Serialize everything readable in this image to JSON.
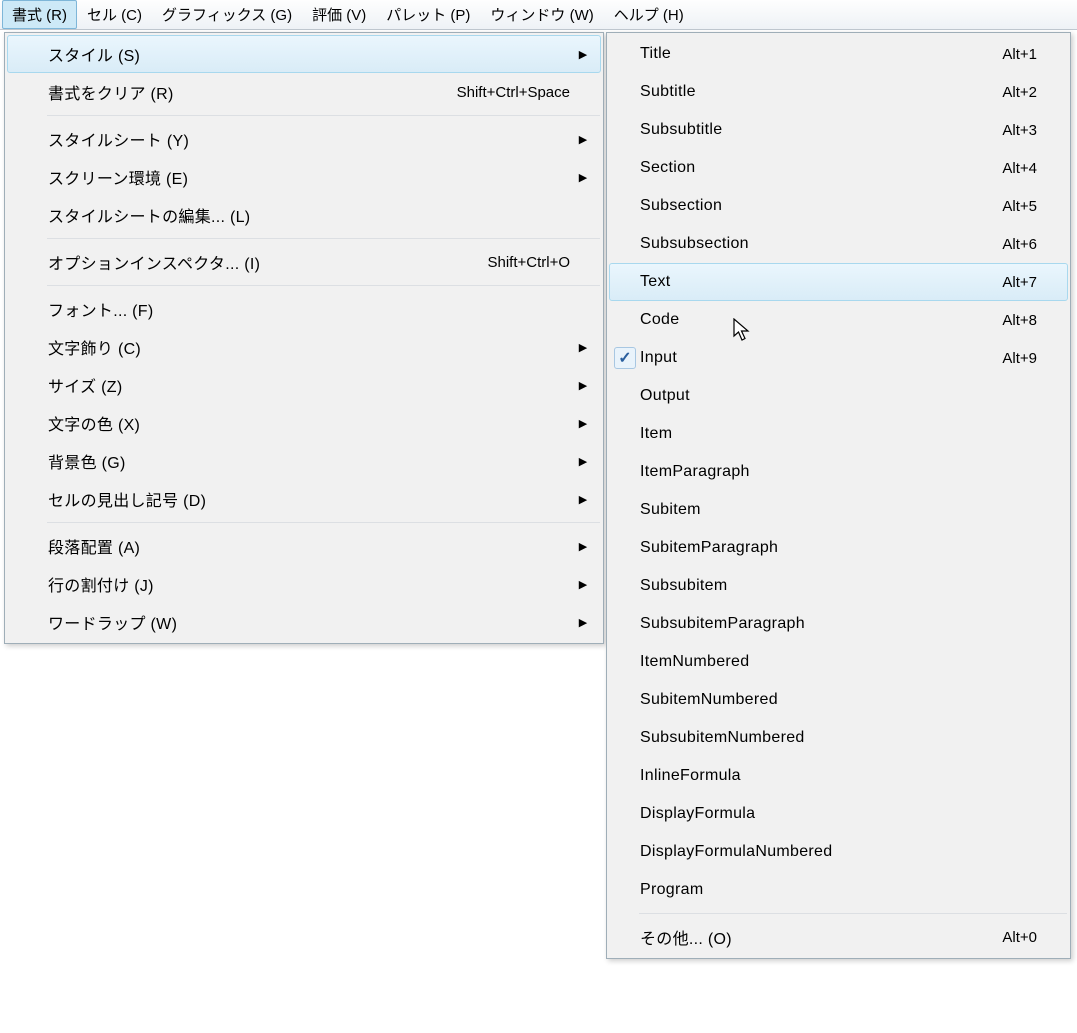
{
  "menubar": {
    "items": [
      {
        "label": "書式 (R)",
        "active": true
      },
      {
        "label": "セル (C)"
      },
      {
        "label": "グラフィックス (G)"
      },
      {
        "label": "評価 (V)"
      },
      {
        "label": "パレット (P)"
      },
      {
        "label": "ウィンドウ (W)"
      },
      {
        "label": "ヘルプ (H)"
      }
    ]
  },
  "primary_menu": {
    "groups": [
      [
        {
          "label": "スタイル (S)",
          "shortcut": "",
          "arrow": true,
          "highlight": true
        },
        {
          "label": "書式をクリア (R)",
          "shortcut": "Shift+Ctrl+Space"
        }
      ],
      [
        {
          "label": "スタイルシート (Y)",
          "arrow": true
        },
        {
          "label": "スクリーン環境 (E)",
          "arrow": true
        },
        {
          "label": "スタイルシートの編集... (L)"
        }
      ],
      [
        {
          "label": "オプションインスペクタ... (I)",
          "shortcut": "Shift+Ctrl+O"
        }
      ],
      [
        {
          "label": "フォント... (F)"
        },
        {
          "label": "文字飾り (C)",
          "arrow": true
        },
        {
          "label": "サイズ (Z)",
          "arrow": true
        },
        {
          "label": "文字の色 (X)",
          "arrow": true
        },
        {
          "label": "背景色 (G)",
          "arrow": true
        },
        {
          "label": "セルの見出し記号 (D)",
          "arrow": true
        }
      ],
      [
        {
          "label": "段落配置 (A)",
          "arrow": true
        },
        {
          "label": "行の割付け (J)",
          "arrow": true
        },
        {
          "label": "ワードラップ (W)",
          "arrow": true
        }
      ]
    ]
  },
  "secondary_menu": {
    "groups": [
      [
        {
          "label": "Title",
          "shortcut": "Alt+1"
        },
        {
          "label": "Subtitle",
          "shortcut": "Alt+2"
        },
        {
          "label": "Subsubtitle",
          "shortcut": "Alt+3"
        },
        {
          "label": "Section",
          "shortcut": "Alt+4"
        },
        {
          "label": "Subsection",
          "shortcut": "Alt+5"
        },
        {
          "label": "Subsubsection",
          "shortcut": "Alt+6"
        },
        {
          "label": "Text",
          "shortcut": "Alt+7",
          "highlight": true
        },
        {
          "label": "Code",
          "shortcut": "Alt+8"
        },
        {
          "label": "Input",
          "shortcut": "Alt+9",
          "checked": true
        },
        {
          "label": "Output"
        },
        {
          "label": "Item"
        },
        {
          "label": "ItemParagraph"
        },
        {
          "label": "Subitem"
        },
        {
          "label": "SubitemParagraph"
        },
        {
          "label": "Subsubitem"
        },
        {
          "label": "SubsubitemParagraph"
        },
        {
          "label": "ItemNumbered"
        },
        {
          "label": "SubitemNumbered"
        },
        {
          "label": "SubsubitemNumbered"
        },
        {
          "label": "InlineFormula"
        },
        {
          "label": "DisplayFormula"
        },
        {
          "label": "DisplayFormulaNumbered"
        },
        {
          "label": "Program"
        }
      ],
      [
        {
          "label": "その他... (O)",
          "shortcut": "Alt+0"
        }
      ]
    ]
  }
}
